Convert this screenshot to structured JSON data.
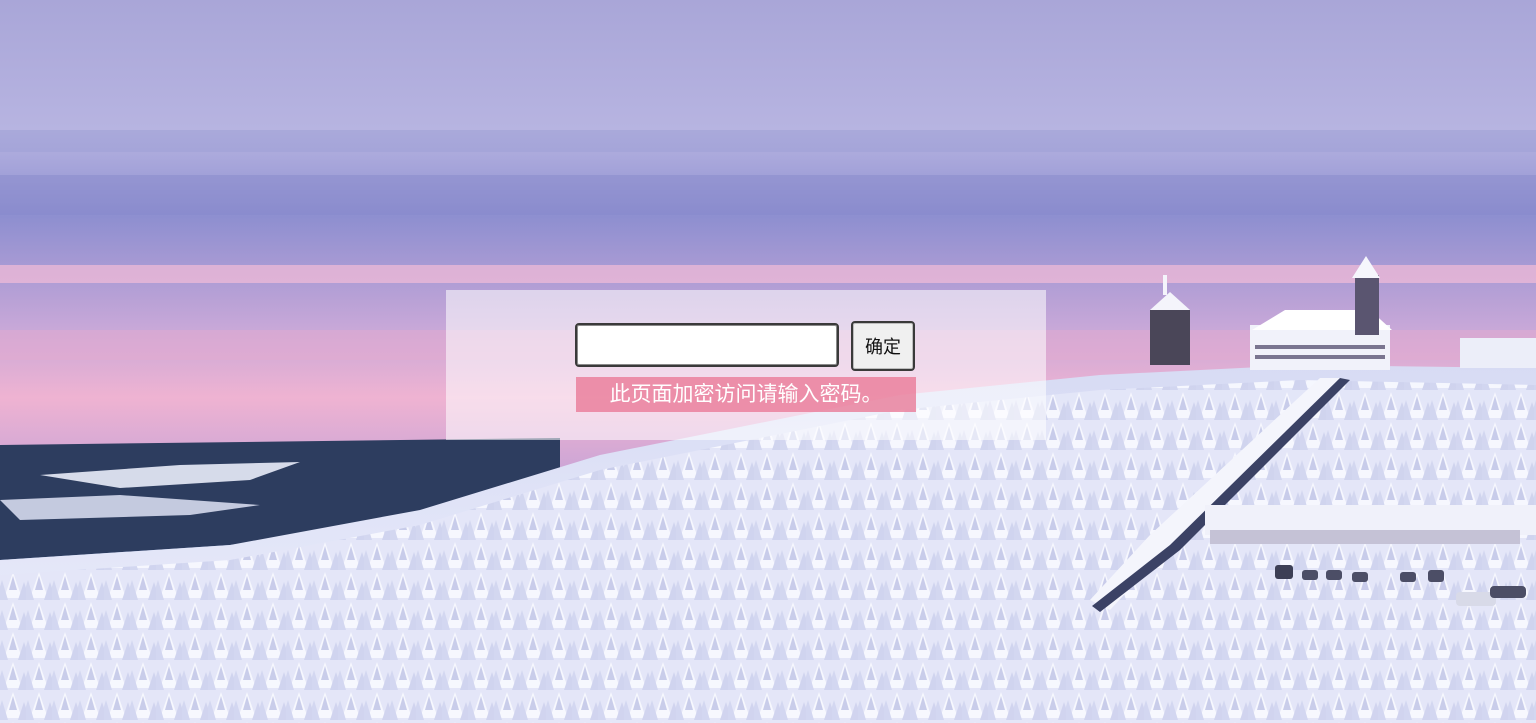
{
  "login": {
    "password_value": "",
    "confirm_label": "确定",
    "hint_text": "此页面加密访问请输入密码。"
  },
  "colors": {
    "hint_background": "#e97896",
    "panel_background": "#ffffff",
    "button_background": "#f0f0f0"
  }
}
